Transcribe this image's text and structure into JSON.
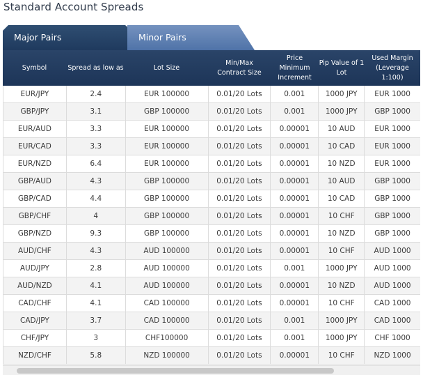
{
  "page": {
    "title": "Standard Account Spreads"
  },
  "tabs": [
    {
      "label": "Major Pairs",
      "active": false
    },
    {
      "label": "Minor Pairs",
      "active": true
    }
  ],
  "table": {
    "headers": [
      "Symbol",
      "Spread as low as",
      "Lot Size",
      "Min/Max\nContract Size",
      "Price Minimum\nIncrement",
      "Pip Value of 1\nLot",
      "Used Margin\n(Leverage 1:100)"
    ],
    "rows": [
      [
        "EUR/JPY",
        "2.4",
        "EUR 100000",
        "0.01/20 Lots",
        "0.001",
        "1000 JPY",
        "EUR 1000"
      ],
      [
        "GBP/JPY",
        "3.1",
        "GBP 100000",
        "0.01/20 Lots",
        "0.001",
        "1000 JPY",
        "GBP 1000"
      ],
      [
        "EUR/AUD",
        "3.3",
        "EUR 100000",
        "0.01/20 Lots",
        "0.00001",
        "10 AUD",
        "EUR 1000"
      ],
      [
        "EUR/CAD",
        "3.3",
        "EUR 100000",
        "0.01/20 Lots",
        "0.00001",
        "10 CAD",
        "EUR 1000"
      ],
      [
        "EUR/NZD",
        "6.4",
        "EUR 100000",
        "0.01/20 Lots",
        "0.00001",
        "10 NZD",
        "EUR 1000"
      ],
      [
        "GBP/AUD",
        "4.3",
        "GBP 100000",
        "0.01/20 Lots",
        "0.00001",
        "10 AUD",
        "GBP 1000"
      ],
      [
        "GBP/CAD",
        "4.4",
        "GBP 100000",
        "0.01/20 Lots",
        "0.00001",
        "10 CAD",
        "GBP 1000"
      ],
      [
        "GBP/CHF",
        "4",
        "GBP 100000",
        "0.01/20 Lots",
        "0.00001",
        "10 CHF",
        "GBP 1000"
      ],
      [
        "GBP/NZD",
        "9.3",
        "GBP 100000",
        "0.01/20 Lots",
        "0.00001",
        "10 NZD",
        "GBP 1000"
      ],
      [
        "AUD/CHF",
        "4.3",
        "AUD 100000",
        "0.01/20 Lots",
        "0.00001",
        "10 CHF",
        "AUD 1000"
      ],
      [
        "AUD/JPY",
        "2.8",
        "AUD 100000",
        "0.01/20 Lots",
        "0.001",
        "1000 JPY",
        "AUD 1000"
      ],
      [
        "AUD/NZD",
        "4.1",
        "AUD 100000",
        "0.01/20 Lots",
        "0.00001",
        "10 NZD",
        "AUD 1000"
      ],
      [
        "CAD/CHF",
        "4.1",
        "CAD 100000",
        "0.01/20 Lots",
        "0.00001",
        "10 CHF",
        "CAD 1000"
      ],
      [
        "CAD/JPY",
        "3.7",
        "CAD 100000",
        "0.01/20 Lots",
        "0.001",
        "1000 JPY",
        "CAD 1000"
      ],
      [
        "CHF/JPY",
        "3",
        "CHF100000",
        "0.01/20 Lots",
        "0.001",
        "1000 JPY",
        "CHF 1000"
      ],
      [
        "NZD/CHF",
        "5.8",
        "NZD 100000",
        "0.01/20 Lots",
        "0.00001",
        "10 CHF",
        "NZD 1000"
      ]
    ]
  },
  "colors": {
    "header_bg": "#1d3558",
    "active_tab": "#5b7cb0",
    "inactive_tab": "#23406a"
  }
}
